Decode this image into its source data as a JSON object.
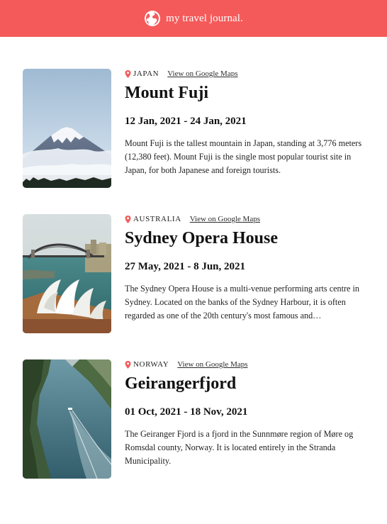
{
  "header": {
    "title": "my travel journal.",
    "color": "#F55A5A",
    "icon": "globe-icon"
  },
  "entries": [
    {
      "country": "JAPAN",
      "maps_link": "View on Google Maps",
      "place": "Mount Fuji",
      "dates": "12 Jan, 2021 - 24 Jan, 2021",
      "description": "Mount Fuji is the tallest mountain in Japan, standing at 3,776 meters (12,380 feet). Mount Fuji is the single most popular tourist site in Japan, for both Japanese and foreign tourists."
    },
    {
      "country": "AUSTRALIA",
      "maps_link": "View on Google Maps",
      "place": "Sydney Opera House",
      "dates": "27 May, 2021 - 8 Jun, 2021",
      "description": "The Sydney Opera House is a multi-venue performing arts centre in Sydney. Located on the banks of the Sydney Harbour, it is often regarded as one of the 20th century's most famous and…"
    },
    {
      "country": "NORWAY",
      "maps_link": "View on Google Maps",
      "place": "Geirangerfjord",
      "dates": "01 Oct, 2021 - 18 Nov, 2021",
      "description": "The Geiranger Fjord is a fjord in the Sunnmøre region of Møre og Romsdal county, Norway. It is located entirely in the Stranda Municipality."
    }
  ]
}
